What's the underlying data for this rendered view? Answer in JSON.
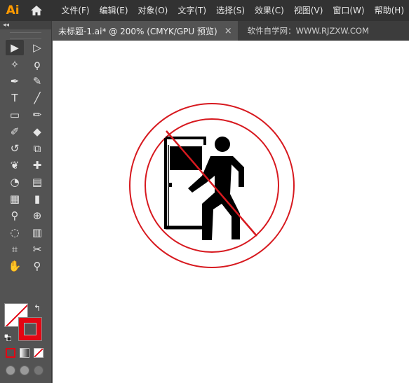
{
  "app": {
    "logo": "Ai",
    "home_icon": "home-icon"
  },
  "menu": [
    "文件(F)",
    "编辑(E)",
    "对象(O)",
    "文字(T)",
    "选择(S)",
    "效果(C)",
    "视图(V)",
    "窗口(W)",
    "帮助(H)"
  ],
  "tabs": {
    "document": "未标题-1.ai* @ 200% (CMYK/GPU 预览)",
    "close": "×",
    "watermark": "软件自学网：WWW.RJZXW.COM"
  },
  "toolbar": {
    "collapse": "◂◂",
    "tools": [
      [
        "selection-tool-icon",
        "direct-selection-tool-icon"
      ],
      [
        "magic-wand-tool-icon",
        "lasso-tool-icon"
      ],
      [
        "pen-tool-icon",
        "curvature-tool-icon"
      ],
      [
        "type-tool-icon",
        "line-segment-tool-icon"
      ],
      [
        "rectangle-tool-icon",
        "paintbrush-tool-icon"
      ],
      [
        "shaper-tool-icon",
        "eraser-tool-icon"
      ],
      [
        "rotate-tool-icon",
        "scale-tool-icon"
      ],
      [
        "warp-tool-icon",
        "puppet-warp-tool-icon"
      ],
      [
        "shape-builder-tool-icon",
        "perspective-grid-tool-icon"
      ],
      [
        "mesh-tool-icon",
        "gradient-tool-icon"
      ],
      [
        "eyedropper-tool-icon",
        "blend-tool-icon"
      ],
      [
        "symbol-sprayer-tool-icon",
        "column-graph-tool-icon"
      ],
      [
        "artboard-tool-icon",
        "slice-tool-icon"
      ],
      [
        "hand-tool-icon",
        "zoom-tool-icon"
      ]
    ],
    "glyphs": [
      [
        "▶",
        "▷"
      ],
      [
        "✧",
        "ϙ"
      ],
      [
        "✒",
        "✎"
      ],
      [
        "T",
        "╱"
      ],
      [
        "▭",
        "✏"
      ],
      [
        "✐",
        "◆"
      ],
      [
        "↺",
        "⧉"
      ],
      [
        "❦",
        "✚"
      ],
      [
        "◔",
        "▤"
      ],
      [
        "▦",
        "▮"
      ],
      [
        "⚲",
        "⊕"
      ],
      [
        "◌",
        "▥"
      ],
      [
        "⌗",
        "✂"
      ],
      [
        "✋",
        "⚲"
      ]
    ],
    "swap_glyph": "↰"
  },
  "colors": {
    "fill": "#ffffff",
    "stroke": "#e30613",
    "sign_red": "#d7191f",
    "figure_black": "#000000"
  }
}
